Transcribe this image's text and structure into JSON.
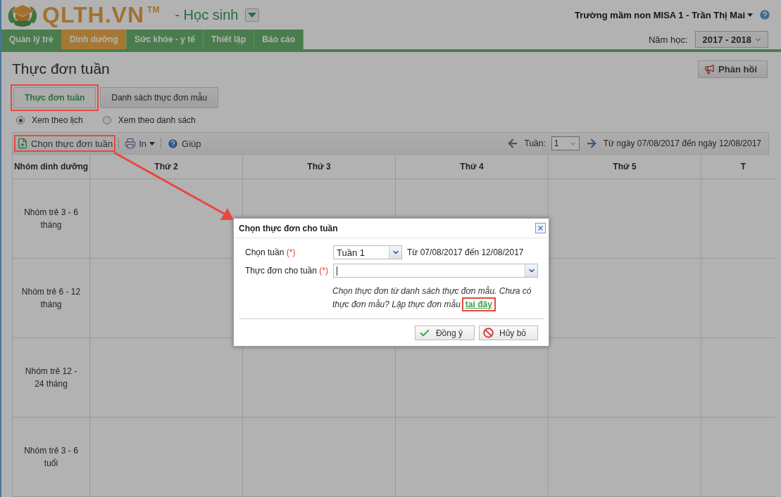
{
  "header": {
    "logo_text": "QLTH.VN",
    "logo_mark": "TM",
    "role": "- Học sinh",
    "user": "Trường mầm non MISA 1 - Trần Thị Mai"
  },
  "nav": {
    "tabs": [
      {
        "label": "Quản lý trẻ",
        "selected": false
      },
      {
        "label": "Dinh dưỡng",
        "selected": true
      },
      {
        "label": "Sức khỏe - y tế",
        "selected": false
      },
      {
        "label": "Thiết lập",
        "selected": false
      },
      {
        "label": "Báo cáo",
        "selected": false
      }
    ],
    "year_label": "Năm học:",
    "year_value": "2017 - 2018"
  },
  "page": {
    "title": "Thực đơn tuần",
    "feedback_button": "Phản hồi"
  },
  "sub_tabs": [
    {
      "label": "Thực đơn tuần",
      "selected": true,
      "highlighted": true
    },
    {
      "label": "Danh sách thực đơn mẫu",
      "selected": false,
      "highlighted": false
    }
  ],
  "view_options": [
    {
      "label": "Xem theo lịch",
      "selected": true
    },
    {
      "label": "Xem theo danh sách",
      "selected": false
    }
  ],
  "toolbar": {
    "items": [
      {
        "kind": "add",
        "label": "Chọn thực đơn tuần",
        "highlighted": true
      },
      {
        "kind": "print",
        "label": "In",
        "highlighted": false
      },
      {
        "kind": "help",
        "label": "Giúp",
        "highlighted": false
      }
    ],
    "week_label": "Tuần:",
    "week_value": "1",
    "range": "Từ ngày 07/08/2017 đến ngày 12/08/2017"
  },
  "table": {
    "columns": [
      "Nhóm dinh dưỡng",
      "Thứ 2",
      "Thứ 3",
      "Thứ 4",
      "Thứ 5",
      "T"
    ],
    "rows": [
      {
        "group": "Nhóm trẻ 3 - 6 tháng"
      },
      {
        "group": "Nhóm trẻ 6 - 12 tháng"
      },
      {
        "group": "Nhóm trẻ 12 - 24 tháng"
      },
      {
        "group": "Nhóm trẻ 3 - 6 tuổi"
      }
    ]
  },
  "dialog": {
    "title": "Chọn thực đơn cho tuần",
    "fields": [
      {
        "label": "Chọn tuần",
        "required": "(*)",
        "value": "Tuần 1",
        "note": "Từ 07/08/2017 đến 12/08/2017"
      },
      {
        "label": "Thực đơn cho tuần",
        "required": "(*)"
      }
    ],
    "hint": "Chọn thực đơn từ danh sách thực đơn mẫu. Chưa có thực đơn mẫu? Lập thực đơn mẫu",
    "link": {
      "label": "tai đây",
      "highlighted": true
    },
    "buttons": [
      {
        "kind": "ok",
        "label": "Đồng ý"
      },
      {
        "kind": "cancel",
        "label": "Hủy bỏ"
      }
    ]
  }
}
